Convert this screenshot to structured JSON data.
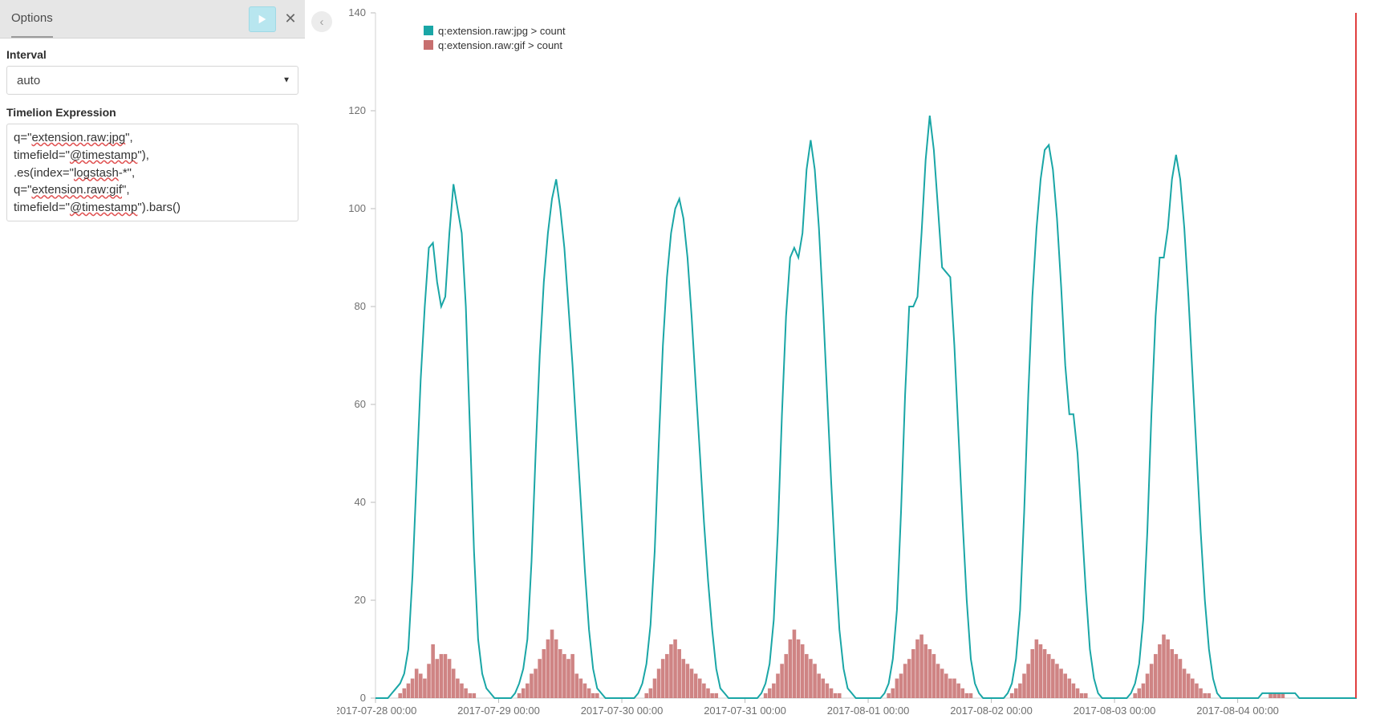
{
  "sidebar": {
    "tab_label": "Options",
    "interval_label": "Interval",
    "interval_value": "auto",
    "expression_label": "Timelion Expression",
    "expression_value": "q=\"extension.raw:jpg\",\ntimefield=\"@timestamp\"),\n.es(index=\"logstash-*\",\nq=\"extension.raw:gif\",\ntimefield=\"@timestamp\").bars()"
  },
  "chart_data": {
    "type": "mixed",
    "ylim": [
      0,
      140
    ],
    "y_ticks": [
      0,
      20,
      40,
      60,
      80,
      100,
      120,
      140
    ],
    "x_ticks": [
      "2017-07-28 00:00",
      "2017-07-29 00:00",
      "2017-07-30 00:00",
      "2017-07-31 00:00",
      "2017-08-01 00:00",
      "2017-08-02 00:00",
      "2017-08-03 00:00",
      "2017-08-04 00:00"
    ],
    "legend": [
      {
        "name": "q:extension.raw:jpg > count",
        "color": "#1aa6a6",
        "shape": "square"
      },
      {
        "name": "q:extension.raw:gif > count",
        "color": "#c76f6f",
        "shape": "square"
      }
    ],
    "peaks": [
      93,
      105,
      106,
      102,
      114,
      119,
      113,
      111
    ],
    "series": [
      {
        "name": "q:extension.raw:jpg > count",
        "type": "line",
        "color": "#1aa6a6",
        "values": [
          0,
          0,
          0,
          0,
          1,
          2,
          3,
          5,
          10,
          25,
          45,
          65,
          80,
          92,
          93,
          85,
          80,
          82,
          95,
          105,
          100,
          95,
          80,
          55,
          30,
          12,
          5,
          2,
          1,
          0,
          0,
          0,
          0,
          0,
          1,
          3,
          6,
          12,
          28,
          50,
          70,
          85,
          95,
          102,
          106,
          100,
          92,
          80,
          68,
          54,
          40,
          26,
          14,
          6,
          2,
          1,
          0,
          0,
          0,
          0,
          0,
          0,
          0,
          0,
          1,
          3,
          7,
          15,
          30,
          52,
          72,
          86,
          95,
          100,
          102,
          98,
          90,
          78,
          64,
          50,
          36,
          24,
          14,
          6,
          2,
          1,
          0,
          0,
          0,
          0,
          0,
          0,
          0,
          0,
          1,
          3,
          7,
          16,
          34,
          58,
          78,
          90,
          92,
          90,
          95,
          108,
          114,
          108,
          96,
          80,
          62,
          44,
          28,
          14,
          6,
          2,
          1,
          0,
          0,
          0,
          0,
          0,
          0,
          0,
          1,
          3,
          8,
          18,
          38,
          62,
          80,
          80,
          82,
          95,
          110,
          119,
          112,
          100,
          88,
          87,
          86,
          72,
          54,
          36,
          20,
          8,
          3,
          1,
          0,
          0,
          0,
          0,
          0,
          0,
          1,
          3,
          8,
          18,
          38,
          62,
          82,
          96,
          106,
          112,
          113,
          108,
          98,
          84,
          68,
          58,
          58,
          50,
          36,
          22,
          10,
          4,
          1,
          0,
          0,
          0,
          0,
          0,
          0,
          0,
          1,
          3,
          7,
          16,
          34,
          58,
          78,
          90,
          90,
          96,
          106,
          111,
          106,
          96,
          82,
          66,
          50,
          34,
          20,
          10,
          4,
          1,
          0,
          0,
          0,
          0,
          0,
          0,
          0,
          0,
          0,
          0,
          1,
          1,
          1,
          1,
          1,
          1,
          1,
          1,
          1,
          0,
          0,
          0,
          0,
          0,
          0,
          0,
          0,
          0,
          0,
          0,
          0,
          0,
          0,
          0
        ]
      },
      {
        "name": "q:extension.raw:gif > count",
        "type": "bar",
        "color": "#c76f6f",
        "values": [
          0,
          0,
          0,
          0,
          0,
          0,
          1,
          2,
          3,
          4,
          6,
          5,
          4,
          7,
          11,
          8,
          9,
          9,
          8,
          6,
          4,
          3,
          2,
          1,
          1,
          0,
          0,
          0,
          0,
          0,
          0,
          0,
          0,
          0,
          0,
          1,
          2,
          3,
          5,
          6,
          8,
          10,
          12,
          14,
          12,
          10,
          9,
          8,
          9,
          5,
          4,
          3,
          2,
          1,
          1,
          0,
          0,
          0,
          0,
          0,
          0,
          0,
          0,
          0,
          0,
          0,
          1,
          2,
          4,
          6,
          8,
          9,
          11,
          12,
          10,
          8,
          7,
          6,
          5,
          4,
          3,
          2,
          1,
          1,
          0,
          0,
          0,
          0,
          0,
          0,
          0,
          0,
          0,
          0,
          0,
          1,
          2,
          3,
          5,
          7,
          9,
          12,
          14,
          12,
          11,
          9,
          8,
          7,
          5,
          4,
          3,
          2,
          1,
          1,
          0,
          0,
          0,
          0,
          0,
          0,
          0,
          0,
          0,
          0,
          0,
          1,
          2,
          4,
          5,
          7,
          8,
          10,
          12,
          13,
          11,
          10,
          9,
          7,
          6,
          5,
          4,
          4,
          3,
          2,
          1,
          1,
          0,
          0,
          0,
          0,
          0,
          0,
          0,
          0,
          0,
          1,
          2,
          3,
          5,
          7,
          10,
          12,
          11,
          10,
          9,
          8,
          7,
          6,
          5,
          4,
          3,
          2,
          1,
          1,
          0,
          0,
          0,
          0,
          0,
          0,
          0,
          0,
          0,
          0,
          0,
          1,
          2,
          3,
          5,
          7,
          9,
          11,
          13,
          12,
          10,
          9,
          8,
          6,
          5,
          4,
          3,
          2,
          1,
          1,
          0,
          0,
          0,
          0,
          0,
          0,
          0,
          0,
          0,
          0,
          0,
          0,
          0,
          0,
          1,
          1,
          1,
          1,
          0,
          0,
          0,
          0,
          0,
          0,
          0,
          0,
          0,
          0,
          0,
          0,
          0,
          0,
          0,
          0,
          0,
          0
        ]
      }
    ]
  }
}
